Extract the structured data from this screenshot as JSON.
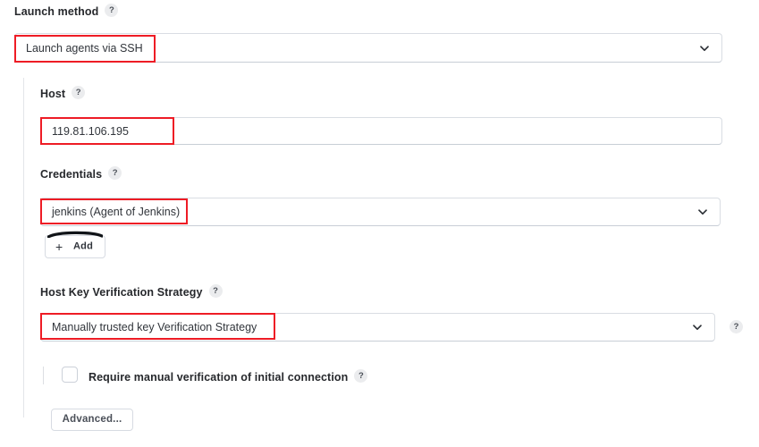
{
  "form": {
    "launch_method": {
      "label": "Launch method",
      "help_icon": "help-question-icon",
      "value": "Launch agents via SSH",
      "chevron_icon": "chevron-down-icon"
    },
    "host": {
      "label": "Host",
      "help_icon": "help-question-icon",
      "value": "119.81.106.195",
      "placeholder": ""
    },
    "credentials": {
      "label": "Credentials",
      "help_icon": "help-question-icon",
      "value": "jenkins (Agent of Jenkins)",
      "chevron_icon": "chevron-down-icon",
      "add_button": {
        "label": "Add",
        "plus_icon": "plus-icon"
      }
    },
    "host_key_verification_strategy": {
      "label": "Host Key Verification Strategy",
      "help_icon": "help-question-icon",
      "value": "Manually trusted key Verification Strategy",
      "chevron_icon": "chevron-down-icon",
      "trailing_help_icon": "help-question-icon"
    },
    "require_manual_verification": {
      "label": "Require manual verification of initial connection",
      "help_icon": "help-question-icon",
      "checked": false
    },
    "advanced_button": {
      "label": "Advanced..."
    }
  },
  "glyphs": {
    "question": "?",
    "plus": "+"
  },
  "colors": {
    "annotation": "#ee1c25",
    "border": "#d9dde3",
    "text": "#31353b",
    "help_bg": "#ebecee"
  }
}
